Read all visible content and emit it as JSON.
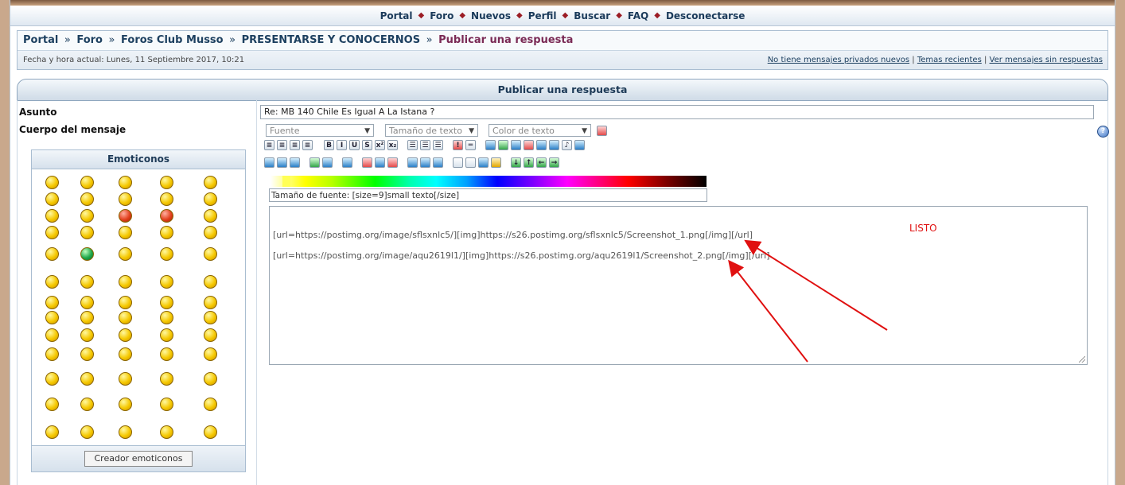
{
  "nav": {
    "items": [
      "Portal",
      "Foro",
      "Nuevos",
      "Perfil",
      "Buscar",
      "FAQ",
      "Desconectarse"
    ],
    "separator": "◆"
  },
  "breadcrumb": {
    "items": [
      "Portal",
      "Foro",
      "Foros Club Musso",
      "PRESENTARSE Y CONOCERNOS"
    ],
    "separator": "»",
    "current": "Publicar una respuesta"
  },
  "status": {
    "datetime": "Fecha y hora actual: Lunes, 11 Septiembre 2017, 10:21",
    "link_pm": "No tiene mensajes privados nuevos",
    "link_recent": "Temas recientes",
    "link_unanswered": "Ver mensajes sin respuestas",
    "link_separator": "|"
  },
  "panel": {
    "title": "Publicar una respuesta"
  },
  "form": {
    "subject_label": "Asunto",
    "subject_value": "Re: MB 140 Chile Es Igual A La Istana ?",
    "body_label": "Cuerpo del mensaje",
    "font_select": "Fuente",
    "size_select": "Tamaño de texto",
    "color_select": "Color de texto",
    "help_glyph": "?",
    "hint": "Tamaño de fuente: [size=9]small texto[/size]",
    "message_lines": [
      "[url=https://postimg.org/image/sflsxnlc5/][img]https://s26.postimg.org/sflsxnlc5/Screenshot_1.png[/img][/url]",
      "[url=https://postimg.org/image/aqu2619l1/][img]https://s26.postimg.org/aqu2619l1/Screenshot_2.png[/img][/url]"
    ]
  },
  "toolbar": {
    "row1": [
      "B",
      "I",
      "U",
      "S",
      "x²",
      "x₂"
    ]
  },
  "emoticons": {
    "title": "Emoticonos",
    "creator_button": "Creador emoticonos"
  },
  "annotation": {
    "text": "LISTO",
    "color": "#e01010"
  },
  "colors": {
    "nav_text": "#1a3a5a",
    "nav_separator": "#9b1c24",
    "breadcrumb_current": "#7a2a55",
    "annotation_red": "#e01010"
  }
}
